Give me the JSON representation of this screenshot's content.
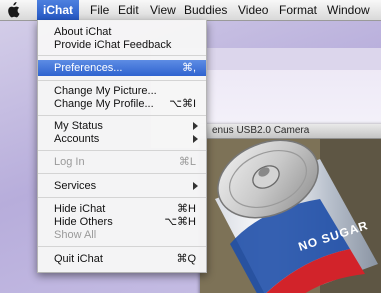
{
  "menubar": {
    "app_menu": "iChat",
    "items": [
      "File",
      "Edit",
      "View",
      "Buddies",
      "Video",
      "Format",
      "Window"
    ],
    "highlight_color": "#2f63cf"
  },
  "ichat_menu": {
    "about": "About iChat",
    "feedback": "Provide iChat Feedback",
    "preferences": {
      "label": "Preferences...",
      "shortcut": "⌘,"
    },
    "change_picture": "Change My Picture...",
    "change_profile": {
      "label": "Change My Profile...",
      "shortcut": "⌥⌘I"
    },
    "my_status": "My Status",
    "accounts": "Accounts",
    "log_in": {
      "label": "Log In",
      "shortcut": "⌘L"
    },
    "services": "Services",
    "hide": {
      "label": "Hide iChat",
      "shortcut": "⌘H"
    },
    "hide_others": {
      "label": "Hide Others",
      "shortcut": "⌥⌘H"
    },
    "show_all": "Show All",
    "quit": {
      "label": "Quit iChat",
      "shortcut": "⌘Q"
    }
  },
  "camera_window": {
    "title": "enus USB2.0 Camera",
    "can_text": "NO SUGAR"
  }
}
